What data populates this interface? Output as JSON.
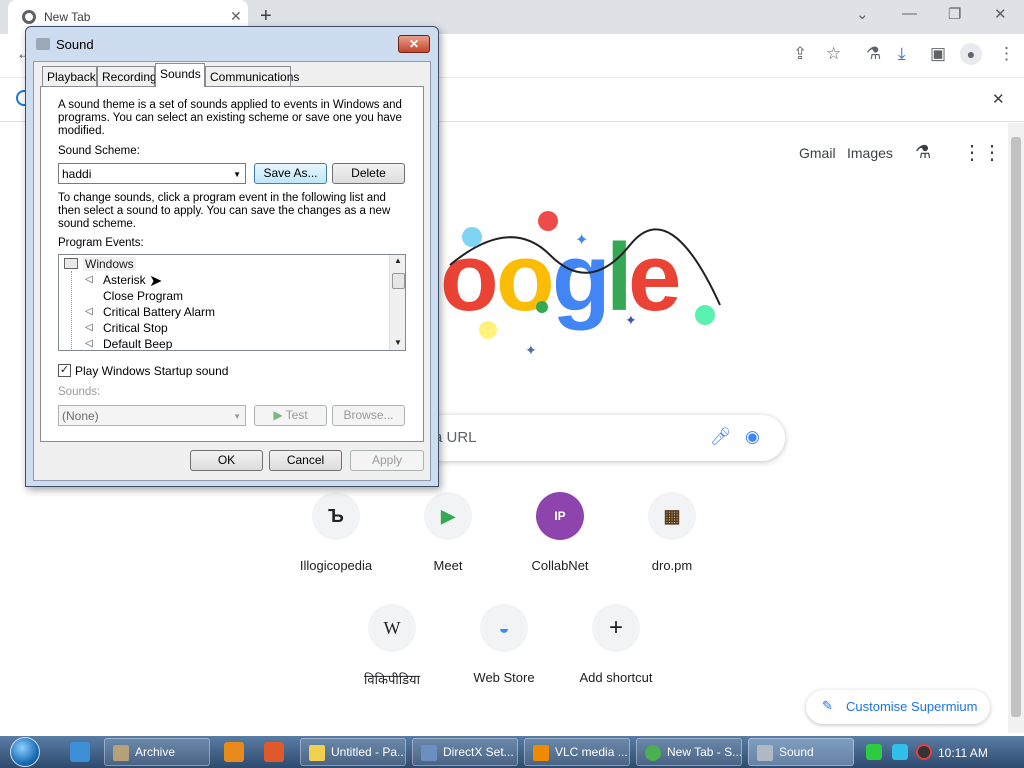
{
  "browser": {
    "tab_title": "New Tab",
    "tab_close": "✕",
    "new_tab": "+",
    "window_controls": [
      "minimize-icon",
      "restore-icon",
      "close-icon"
    ],
    "toolbar_icons": [
      "share-icon",
      "star-icon",
      "labs-icon",
      "download-icon",
      "sidepanel-icon",
      "profile-icon",
      "menu-icon"
    ],
    "infobar_close": "✕"
  },
  "ntp": {
    "links": [
      "Gmail",
      "Images"
    ],
    "search_placeholder": "a URL",
    "shortcuts": [
      {
        "label": "Illogicopedia",
        "glyph": "Ъ"
      },
      {
        "label": "Meet",
        "glyph": "▶"
      },
      {
        "label": "CollabNet",
        "glyph": "IP"
      },
      {
        "label": "dro.pm",
        "glyph": "▦"
      },
      {
        "label": "विकिपीडिया",
        "glyph": "W"
      },
      {
        "label": "Web Store",
        "glyph": "◒"
      },
      {
        "label": "Add shortcut",
        "glyph": "+"
      }
    ],
    "customise": "Customise Supermium"
  },
  "dialog": {
    "title": "Sound",
    "tabs": [
      "Playback",
      "Recording",
      "Sounds",
      "Communications"
    ],
    "selected_tab": "Sounds",
    "intro": "A sound theme is a set of sounds applied to events in Windows and programs.  You can select an existing scheme or save one you have modified.",
    "scheme_label": "Sound Scheme:",
    "scheme_value": "haddi",
    "save_as": "Save As...",
    "delete": "Delete",
    "change_text": "To change sounds, click a program event in the following list and then select a sound to apply.  You can save the changes as a new sound scheme.",
    "events_label": "Program Events:",
    "events_root": "Windows",
    "events": [
      "Asterisk",
      "Close Program",
      "Critical Battery Alarm",
      "Critical Stop",
      "Default Beep"
    ],
    "startup_label": "Play Windows Startup sound",
    "startup_checked": true,
    "sounds_label": "Sounds:",
    "sounds_value": "(None)",
    "test": "Test",
    "browse": "Browse...",
    "ok": "OK",
    "cancel": "Cancel",
    "apply": "Apply"
  },
  "taskbar": {
    "items": [
      "Archive",
      "Untitled - Pa...",
      "DirectX Set...",
      "VLC media ...",
      "New Tab - S...",
      "Sound"
    ],
    "active": "Sound",
    "clock": "10:11 AM"
  }
}
